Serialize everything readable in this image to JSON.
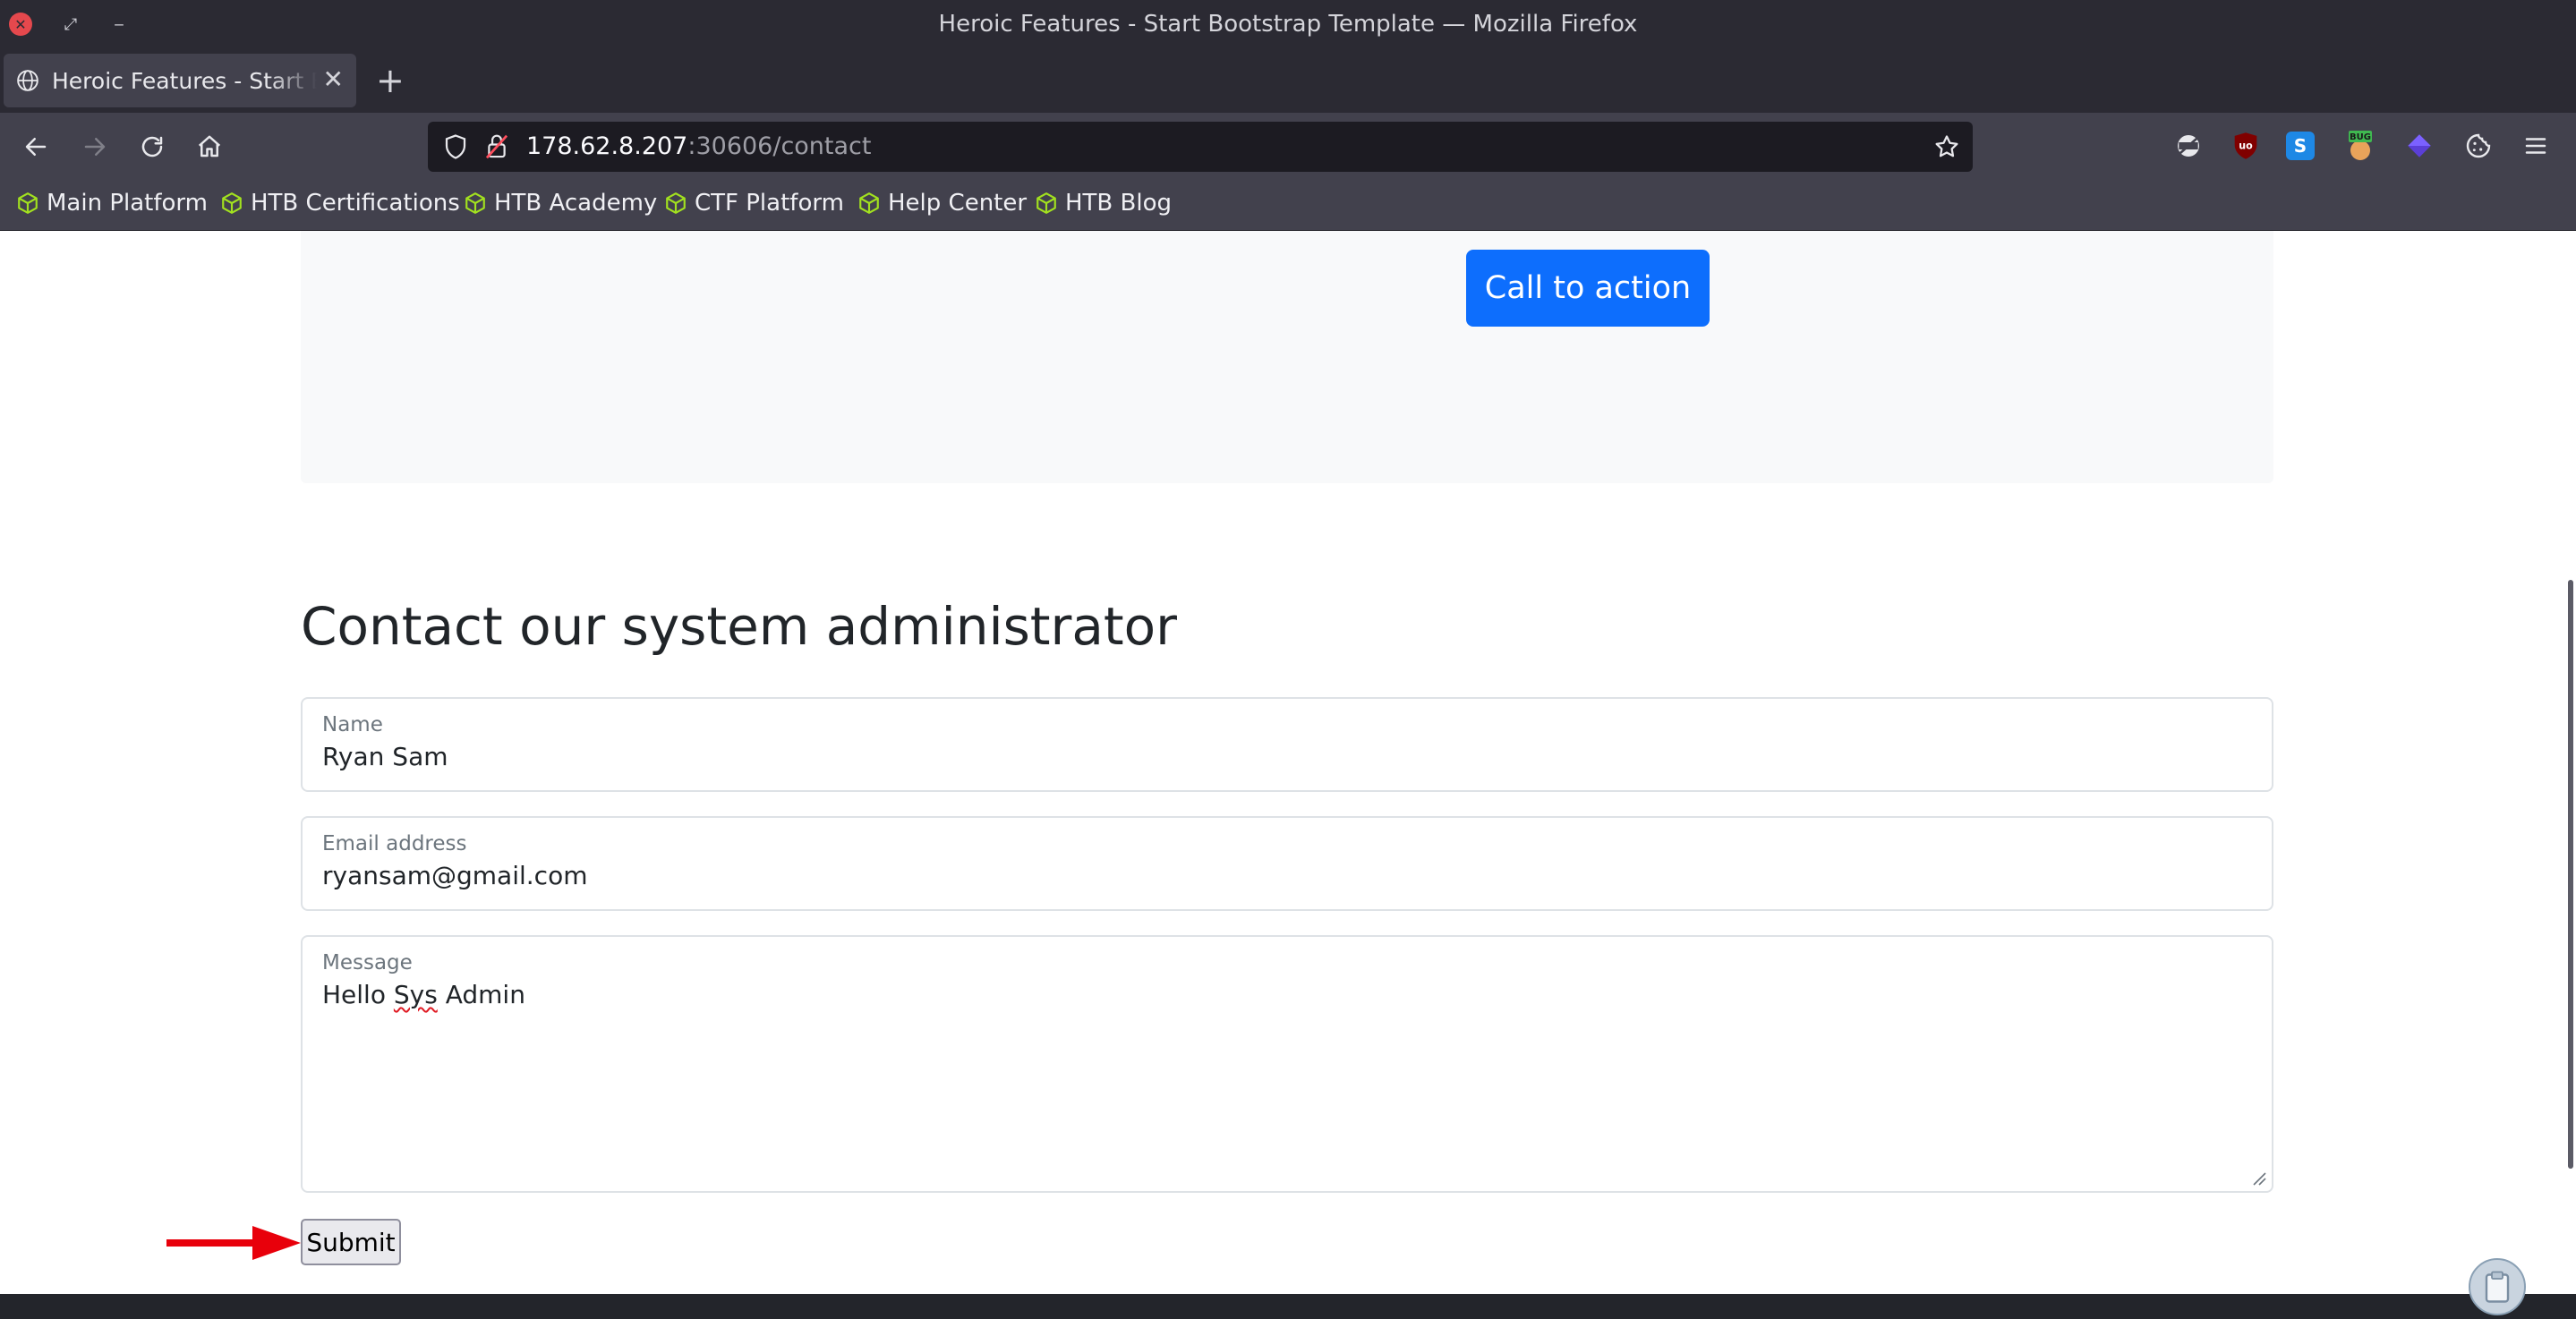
{
  "window": {
    "title": "Heroic Features - Start Bootstrap Template — Mozilla Firefox",
    "close_glyph": "✕",
    "restore_glyph": "⤢",
    "minimize_glyph": "‒"
  },
  "tabs": [
    {
      "label": "Heroic Features - Start Bootstrap Template",
      "close_glyph": "✕"
    }
  ],
  "new_tab_glyph": "+",
  "navbar": {
    "url_host": "178.62.8.207",
    "url_rest": ":30606/contact",
    "icons": [
      "back-icon",
      "forward-icon",
      "reload-icon",
      "home-icon",
      "shield-icon",
      "insecure-lock-icon",
      "star-bookmark-icon"
    ],
    "extensions": [
      "privacy-extension-icon",
      "ublock-origin-icon",
      "s-extension-icon",
      "bug-extension-icon",
      "diamond-extension-icon",
      "cookie-extension-icon",
      "menu-icon"
    ],
    "ublock_label": "uo",
    "s_label": "S",
    "bug_label": "BUG"
  },
  "bookmarks": [
    {
      "label": "Main Platform"
    },
    {
      "label": "HTB Certifications"
    },
    {
      "label": "HTB Academy"
    },
    {
      "label": "CTF Platform"
    },
    {
      "label": "Help Center"
    },
    {
      "label": "HTB Blog"
    }
  ],
  "page": {
    "cta_label": "Call to action",
    "contact_title": "Contact our system administrator",
    "form": {
      "name_label": "Name",
      "name_value": "Ryan Sam",
      "email_label": "Email address",
      "email_value": "ryansam@gmail.com",
      "message_label": "Message",
      "message_value_pre": "Hello ",
      "message_value_misspelled": "Sys",
      "message_value_post": " Admin",
      "submit_label": "Submit"
    }
  },
  "colors": {
    "primary": "#0d6efd",
    "annotation_arrow": "#e8000b",
    "chrome_dark": "#2b2a33",
    "chrome_mid": "#42414d",
    "bookmark_icon": "#a2e11f"
  }
}
